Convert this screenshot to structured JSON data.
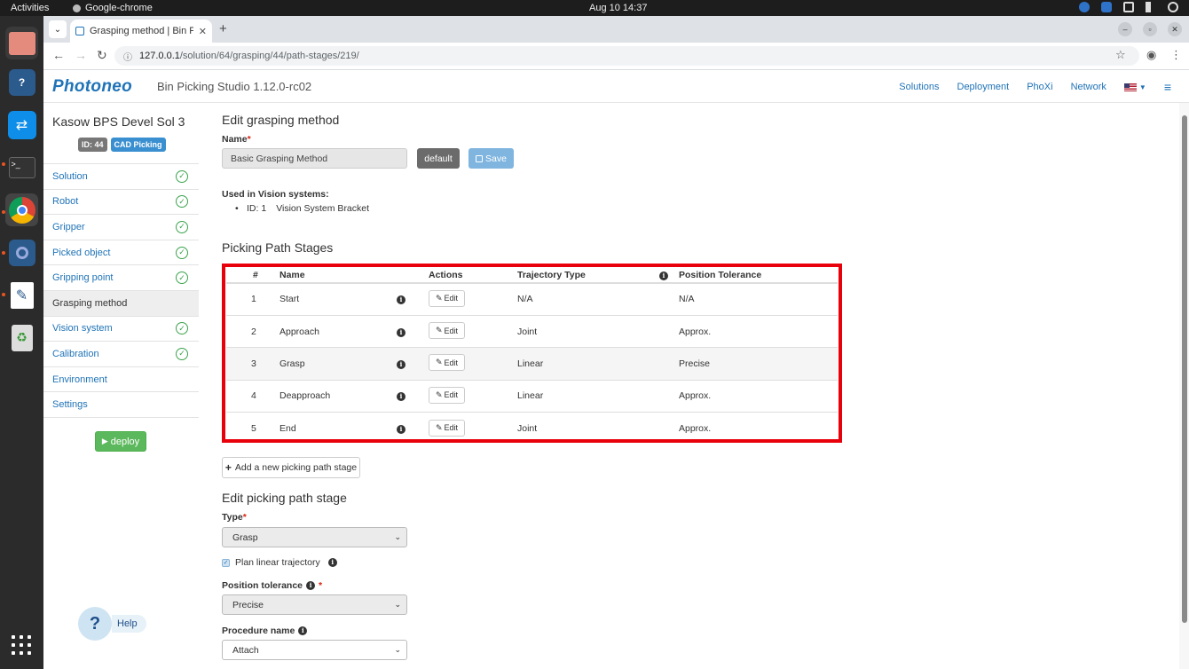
{
  "system": {
    "activities": "Activities",
    "app_name": "Google-chrome",
    "clock": "Aug 10  14:37"
  },
  "browser": {
    "tab_title": "Grasping method | Bin Pi",
    "url_host": "127.0.0.1",
    "url_path": "/solution/64/grasping/44/path-stages/219/"
  },
  "header": {
    "logo": "Photoneo",
    "app_name": "Bin Picking Studio 1.12.0-rc02",
    "nav": [
      "Solutions",
      "Deployment",
      "PhoXi",
      "Network"
    ]
  },
  "sidebar": {
    "title": "Kasow BPS Devel Sol 3",
    "id_badge": "ID: 44",
    "type_badge": "CAD Picking",
    "items": [
      {
        "label": "Solution",
        "done": true
      },
      {
        "label": "Robot",
        "done": true
      },
      {
        "label": "Gripper",
        "done": true
      },
      {
        "label": "Picked object",
        "done": true
      },
      {
        "label": "Gripping point",
        "done": true
      },
      {
        "label": "Grasping method",
        "done": false,
        "active": true
      },
      {
        "label": "Vision system",
        "done": true
      },
      {
        "label": "Calibration",
        "done": true
      },
      {
        "label": "Environment",
        "done": false
      },
      {
        "label": "Settings",
        "done": false
      }
    ],
    "deploy_label": "deploy",
    "help_label": "Help"
  },
  "form": {
    "title": "Edit grasping method",
    "name_label": "Name",
    "name_value": "Basic Grasping Method",
    "default_label": "default",
    "save_label": "Save",
    "used_in_label": "Used in Vision systems:",
    "vision_system_id": "ID: 1",
    "vision_system_name": "Vision System Bracket"
  },
  "stages": {
    "title": "Picking Path Stages",
    "headers": {
      "num": "#",
      "name": "Name",
      "actions": "Actions",
      "trajectory": "Trajectory Type",
      "tolerance": "Position Tolerance"
    },
    "edit_label": "Edit",
    "rows": [
      {
        "num": "1",
        "name": "Start",
        "trajectory": "N/A",
        "tolerance": "N/A"
      },
      {
        "num": "2",
        "name": "Approach",
        "trajectory": "Joint",
        "tolerance": "Approx."
      },
      {
        "num": "3",
        "name": "Grasp",
        "trajectory": "Linear",
        "tolerance": "Precise"
      },
      {
        "num": "4",
        "name": "Deapproach",
        "trajectory": "Linear",
        "tolerance": "Approx."
      },
      {
        "num": "5",
        "name": "End",
        "trajectory": "Joint",
        "tolerance": "Approx."
      }
    ],
    "add_label": "Add a new picking path stage"
  },
  "stage_editor": {
    "title": "Edit picking path stage",
    "type_label": "Type",
    "type_value": "Grasp",
    "plan_linear_label": "Plan linear trajectory",
    "tolerance_label": "Position tolerance",
    "tolerance_value": "Precise",
    "procedure_label": "Procedure name",
    "procedure_value": "Attach"
  },
  "colors": {
    "brand": "#1f73b7",
    "highlight": "#e8000b",
    "success": "#5cb85c"
  }
}
